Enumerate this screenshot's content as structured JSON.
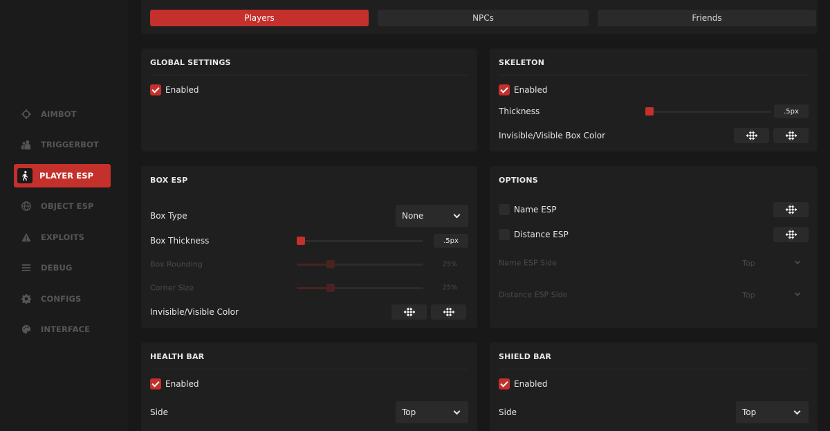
{
  "sidebar": {
    "items": [
      {
        "label": "AIMBOT",
        "icon": "crosshair-icon"
      },
      {
        "label": "TRIGGERBOT",
        "icon": "users-icon"
      },
      {
        "label": "PLAYER ESP",
        "icon": "walking-person-icon",
        "active": true
      },
      {
        "label": "OBJECT ESP",
        "icon": "globe-icon"
      },
      {
        "label": "EXPLOITS",
        "icon": "warning-icon"
      },
      {
        "label": "DEBUG",
        "icon": "menu-icon"
      },
      {
        "label": "CONFIGS",
        "icon": "gear-icon"
      },
      {
        "label": "INTERFACE",
        "icon": "palette-icon"
      }
    ]
  },
  "tabs": [
    {
      "label": "Players",
      "active": true
    },
    {
      "label": "NPCs",
      "active": false
    },
    {
      "label": "Friends",
      "active": false
    }
  ],
  "global_settings": {
    "title": "GLOBAL SETTINGS",
    "enabled_label": "Enabled",
    "enabled": true
  },
  "skeleton": {
    "title": "SKELETON",
    "enabled_label": "Enabled",
    "enabled": true,
    "thickness_label": "Thickness",
    "thickness_value": ".5px",
    "thickness_fraction": 0.0,
    "color_label": "Invisible/Visible Box Color"
  },
  "box_esp": {
    "title": "BOX ESP",
    "box_type_label": "Box Type",
    "box_type_value": "None",
    "box_thickness_label": "Box Thickness",
    "box_thickness_value": ".5px",
    "box_thickness_fraction": 0.0,
    "box_rounding_label": "Box Rounding",
    "box_rounding_value": "25%",
    "box_rounding_fraction": 0.25,
    "corner_size_label": "Corner Size",
    "corner_size_value": "25%",
    "corner_size_fraction": 0.25,
    "color_label": "Invisible/Visible Color"
  },
  "options": {
    "title": "OPTIONS",
    "name_esp_label": "Name ESP",
    "name_esp": false,
    "distance_esp_label": "Distance ESP",
    "distance_esp": false,
    "name_side_label": "Name ESP Side",
    "name_side_value": "Top",
    "distance_side_label": "Distance ESP Side",
    "distance_side_value": "Top"
  },
  "health_bar": {
    "title": "HEALTH BAR",
    "enabled_label": "Enabled",
    "enabled": true,
    "side_label": "Side",
    "side_value": "Top"
  },
  "shield_bar": {
    "title": "SHIELD BAR",
    "enabled_label": "Enabled",
    "enabled": true,
    "side_label": "Side",
    "side_value": "Top"
  },
  "colors": {
    "accent": "#c4302b",
    "panel": "#1f1f1f",
    "background": "#181818"
  }
}
